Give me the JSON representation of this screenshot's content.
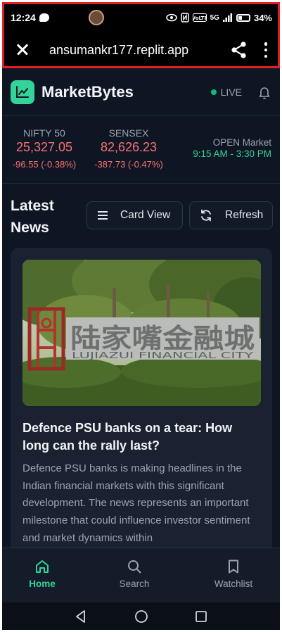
{
  "status_bar": {
    "time": "12:24",
    "network": "5G",
    "battery": "34%"
  },
  "browser": {
    "url": "ansumankr177.replit.app"
  },
  "app": {
    "name": "MarketBytes",
    "live_label": "LIVE",
    "accent_color": "#34d399"
  },
  "ticker": {
    "indices": [
      {
        "name": "NIFTY 50",
        "value": "25,327.05",
        "change": "-96.55 (-0.38%)"
      },
      {
        "name": "SENSEX",
        "value": "82,626.23",
        "change": "-387.73 (-0.47%)"
      }
    ],
    "market_status": "OPEN Market",
    "market_hours": "9:15 AM - 3:30 PM"
  },
  "news": {
    "heading_line1": "Latest",
    "heading_line2": "News",
    "card_view_label": "Card View",
    "refresh_label": "Refresh",
    "article": {
      "image_sign_cn": "陆家嘴金融城",
      "image_sign_en": "LUJIAZUI FINANCIAL CITY",
      "title": "Defence PSU banks on a tear: How long can the rally last?",
      "excerpt": "Defence PSU banks is making headlines in the Indian financial markets with this significant development. The news represents an important milestone that could influence investor sentiment and market dynamics within"
    }
  },
  "bottom_nav": {
    "items": [
      {
        "label": "Home",
        "icon": "home-icon",
        "active": true
      },
      {
        "label": "Search",
        "icon": "search-icon",
        "active": false
      },
      {
        "label": "Watchlist",
        "icon": "bookmark-icon",
        "active": false
      }
    ]
  }
}
